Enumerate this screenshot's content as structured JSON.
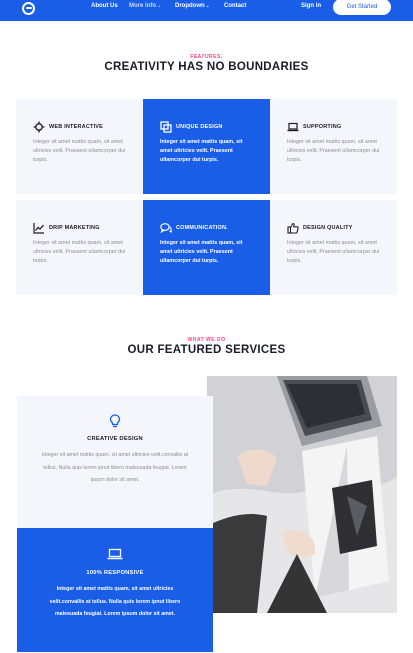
{
  "nav": {
    "links": [
      "About Us",
      "More info",
      "Dropdown",
      "Contact"
    ],
    "signin": "Sign in",
    "cta": "Get Started",
    "brand_color": "#1a5ee8"
  },
  "features": {
    "eyebrow": "FEATURES.",
    "title": "CREATIVITY HAS NO BOUNDARIES",
    "cards": [
      {
        "title": "WEB INTERACTIVE",
        "icon": "crosshair-icon",
        "text": "Integer sit amet mattis quam, sit amet ultricies velit. Praesent ullamcorper dui turpis."
      },
      {
        "title": "UNIQUE DESIGN",
        "icon": "copy-icon",
        "text": "Integer sit amet mattis quam, sit amet ultricies velit. Praesent ullamcorper dui turpis."
      },
      {
        "title": "SUPPORTING",
        "icon": "laptop-icon",
        "text": "Integer sit amet mattis quam, sit amet ultricies velit. Praesent ullamcorper dui turpis."
      },
      {
        "title": "DRIP MARKETING",
        "icon": "chart-icon",
        "text": "Integer sit amet mattis quam, sit amet ultricies velit. Praesent ullamcorper dui turpis."
      },
      {
        "title": "COMMUNICATION.",
        "icon": "chat-icon",
        "text": "Integer sit amet mattis quam, sit amet ultricies velit. Praesent ullamcorper dui turpis."
      },
      {
        "title": "DESIGN QUALITY",
        "icon": "thumbs-up-icon",
        "text": "Integer sit amet mattis quam, sit amet ultricies velit. Praesent ullamcorper dui turpis."
      }
    ]
  },
  "services": {
    "eyebrow": "WHAT WE DO",
    "title": "OUR FEATURED SERVICES",
    "items": [
      {
        "title": "CREATIVE DESIGN",
        "icon": "lightbulb-icon",
        "text": "Integer sit amet mattis quam, sit amet ultricies velit.convallis at tellus. Nulla quis lorem ipnut libero malesuada feugiat. Lorem ipsum dolor sit amet."
      },
      {
        "title": "100% RESPONSIVE",
        "icon": "laptop-icon",
        "text": "Integer sit amet mattis quam, sit amet ultricies velit.convallis at tellus. Nulla quis lorem ipnut libero malesuada feugiat. Lorem ipsum dolor sit amet."
      }
    ]
  },
  "colors": {
    "accent": "#ff3e7f",
    "card_bg": "#f5f6fb"
  }
}
